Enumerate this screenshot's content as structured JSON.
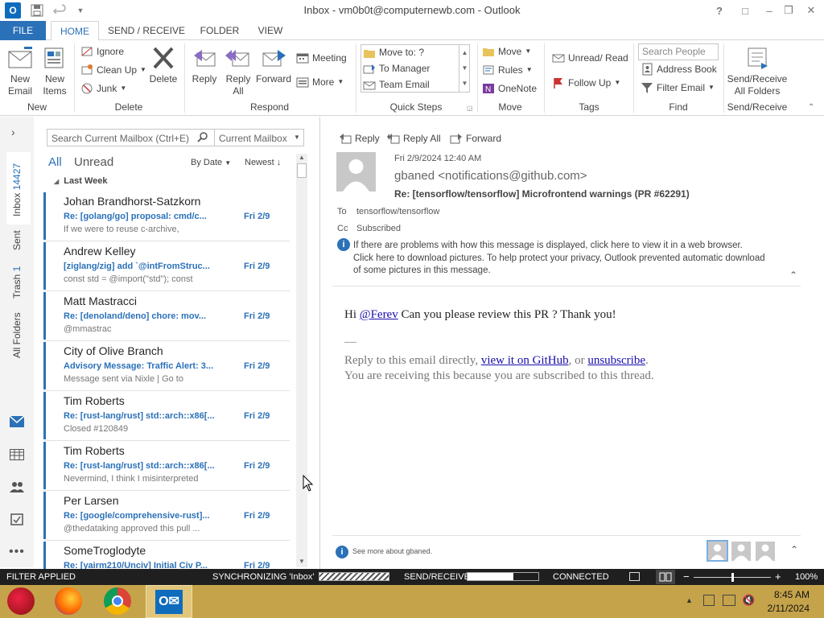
{
  "window": {
    "title": "Inbox - vm0b0t@computernewb.com - Outlook",
    "controls": [
      "?",
      "□",
      "–",
      "❐",
      "✕"
    ]
  },
  "ribbon_tabs": {
    "file": "FILE",
    "home": "HOME",
    "send_receive": "SEND / RECEIVE",
    "folder": "FOLDER",
    "view": "VIEW"
  },
  "ribbon": {
    "new": {
      "new_email": "New\nEmail",
      "new_items": "New\nItems",
      "label": "New"
    },
    "delete": {
      "ignore": "Ignore",
      "clean_up": "Clean Up",
      "junk": "Junk",
      "delete": "Delete",
      "label": "Delete"
    },
    "respond": {
      "reply": "Reply",
      "reply_all": "Reply\nAll",
      "forward": "Forward",
      "meeting": "Meeting",
      "more": "More",
      "label": "Respond"
    },
    "quick_steps": {
      "items": [
        "Move to: ?",
        "To Manager",
        "Team Email"
      ],
      "label": "Quick Steps"
    },
    "move": {
      "move": "Move",
      "rules": "Rules",
      "onenote": "OneNote",
      "label": "Move"
    },
    "tags": {
      "unread_read": "Unread/ Read",
      "follow_up": "Follow Up",
      "label": "Tags"
    },
    "find": {
      "search_people": "Search People",
      "address_book": "Address Book",
      "filter_email": "Filter Email",
      "label": "Find"
    },
    "send_receive": {
      "button": "Send/Receive\nAll Folders",
      "label": "Send/Receive"
    }
  },
  "leftnav": {
    "folders": [
      {
        "name": "Inbox",
        "count": "14427"
      },
      {
        "name": "Sent",
        "count": ""
      },
      {
        "name": "Trash",
        "count": "1"
      },
      {
        "name": "All Folders",
        "count": ""
      }
    ]
  },
  "msglist": {
    "search_placeholder": "Search Current Mailbox (Ctrl+E)",
    "scope": "Current Mailbox",
    "filter_all": "All",
    "filter_unread": "Unread",
    "sort_by": "By Date",
    "sort_order": "Newest",
    "group_label": "Last Week",
    "messages": [
      {
        "from": "Johan Brandhorst-Satzkorn",
        "subject": "Re: [golang/go] proposal: cmd/c...",
        "date": "Fri 2/9",
        "preview": "If we were to reuse c-archive,"
      },
      {
        "from": "Andrew Kelley",
        "subject": "[ziglang/zig] add `@intFromStruc...",
        "date": "Fri 2/9",
        "preview": "const std = @import(\"std\");  const"
      },
      {
        "from": "Matt Mastracci",
        "subject": "Re: [denoland/deno] chore: mov...",
        "date": "Fri 2/9",
        "preview": "@mmastrac"
      },
      {
        "from": "City of Olive Branch",
        "subject": "Advisory Message: Traffic Alert: 3...",
        "date": "Fri 2/9",
        "preview": "Message sent via Nixle | Go to"
      },
      {
        "from": "Tim Roberts",
        "subject": "Re: [rust-lang/rust] std::arch::x86[...",
        "date": "Fri 2/9",
        "preview": "Closed #120849"
      },
      {
        "from": "Tim Roberts",
        "subject": "Re: [rust-lang/rust] std::arch::x86[...",
        "date": "Fri 2/9",
        "preview": "Nevermind, I think I misinterpreted"
      },
      {
        "from": "Per Larsen",
        "subject": "Re: [google/comprehensive-rust]...",
        "date": "Fri 2/9",
        "preview": "@thedataking approved this pull ..."
      },
      {
        "from": "SomeTroglodyte",
        "subject": "Re: [yairm210/Unciv] Initial Civ P...",
        "date": "Fri 2/9",
        "preview": ""
      }
    ]
  },
  "reading": {
    "actions": {
      "reply": "Reply",
      "reply_all": "Reply All",
      "forward": "Forward"
    },
    "datetime": "Fri 2/9/2024 12:40 AM",
    "sender": "gbaned <notifications@github.com>",
    "subject": "Re: [tensorflow/tensorflow] Microfrontend warnings (PR #62291)",
    "to_label": "To",
    "to": "tensorflow/tensorflow",
    "cc_label": "Cc",
    "cc": "Subscribed",
    "info_line1": "If there are problems with how this message is displayed, click here to view it in a web browser.",
    "info_line2": "Click here to download pictures. To help protect your privacy, Outlook prevented automatic download",
    "info_line3": "of some pictures in this message.",
    "body": {
      "greeting": "Hi ",
      "mention": "@Ferev",
      "text": " Can you please review this PR ? Thank you!",
      "dash": "—",
      "footer1_a": "Reply to this email directly, ",
      "footer1_link1": "view it on GitHub",
      "footer1_b": ", or ",
      "footer1_link2": "unsubscribe",
      "footer1_c": ".",
      "footer2": "You are receiving this because you are subscribed to this thread."
    },
    "people_pane": "See more about gbaned."
  },
  "status": {
    "filter": "FILTER APPLIED",
    "sync": "SYNCHRONIZING  'Inbox'",
    "send_receive": "SEND/RECEIVE",
    "connected": "CONNECTED",
    "zoom": "100%",
    "send_receive_progress": 0.65,
    "zoom_level": 1.0
  },
  "taskbar": {
    "time": "8:45 AM",
    "date": "2/11/2024"
  },
  "colors": {
    "accent": "#2b71b8",
    "statusbar": "#1f1f1f",
    "taskbar": "#c5a34a"
  }
}
